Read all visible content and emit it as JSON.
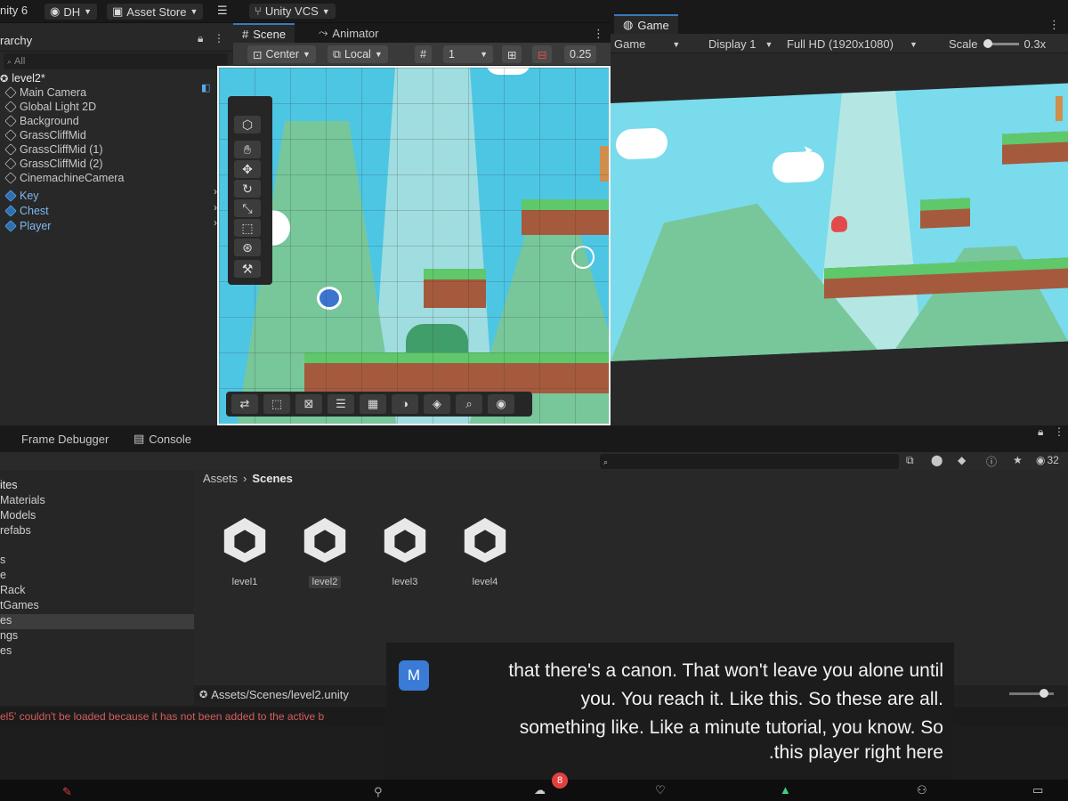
{
  "topbar": {
    "app": "nity 6",
    "account": "DH",
    "asset_store": "Asset Store",
    "vcs": "Unity VCS"
  },
  "hierarchy": {
    "tab": "rarchy",
    "search_placeholder": "All",
    "scene": "level2*",
    "items": [
      {
        "label": "Main Camera"
      },
      {
        "label": "Global Light 2D"
      },
      {
        "label": "Background"
      },
      {
        "label": "GrassCliffMid"
      },
      {
        "label": "GrassCliffMid (1)"
      },
      {
        "label": "GrassCliffMid (2)"
      },
      {
        "label": "CinemachineCamera"
      },
      {
        "label": "Key"
      },
      {
        "label": "Chest"
      },
      {
        "label": "Player"
      }
    ]
  },
  "scene": {
    "tab_scene": "Scene",
    "tab_animator": "Animator",
    "pivot": "Center",
    "space": "Local",
    "grid_value": "1",
    "snap_value": "0.25"
  },
  "game": {
    "tab": "Game",
    "mode": "Game",
    "display": "Display 1",
    "resolution": "Full HD (1920x1080)",
    "scale_label": "Scale",
    "scale_value": "0.3x"
  },
  "bottom": {
    "tab_frame_debugger": "Frame Debugger",
    "tab_console": "Console",
    "badge_count": "32"
  },
  "project": {
    "folders": [
      {
        "label": "ites"
      },
      {
        "label": "Materials"
      },
      {
        "label": "Models"
      },
      {
        "label": "refabs"
      },
      {
        "label": "s"
      },
      {
        "label": "e"
      },
      {
        "label": "Rack"
      },
      {
        "label": "tGames"
      },
      {
        "label": "es"
      },
      {
        "label": "ngs"
      },
      {
        "label": "es"
      }
    ],
    "breadcrumb_root": "Assets",
    "breadcrumb_current": "Scenes",
    "assets": [
      {
        "label": "level1"
      },
      {
        "label": "level2"
      },
      {
        "label": "level3"
      },
      {
        "label": "level4"
      }
    ],
    "path": "Assets/Scenes/level2.unity"
  },
  "status": {
    "message": "el5' couldn't be loaded because it has not been added to the active b"
  },
  "caption": {
    "avatar": "M",
    "lines": [
      "that there's a canon. That won't leave you alone until",
      "you. You reach it. Like this. So these are all.",
      "something like. Like a minute tutorial, you know. So",
      ".this player right here"
    ]
  },
  "taskbar": {
    "notification_count": "8"
  },
  "colors": {
    "accent": "#3a79bb",
    "sky": "#4dc6e4",
    "grass": "#5fc86b",
    "dirt": "#a55a3e",
    "error": "#d55d5d"
  }
}
